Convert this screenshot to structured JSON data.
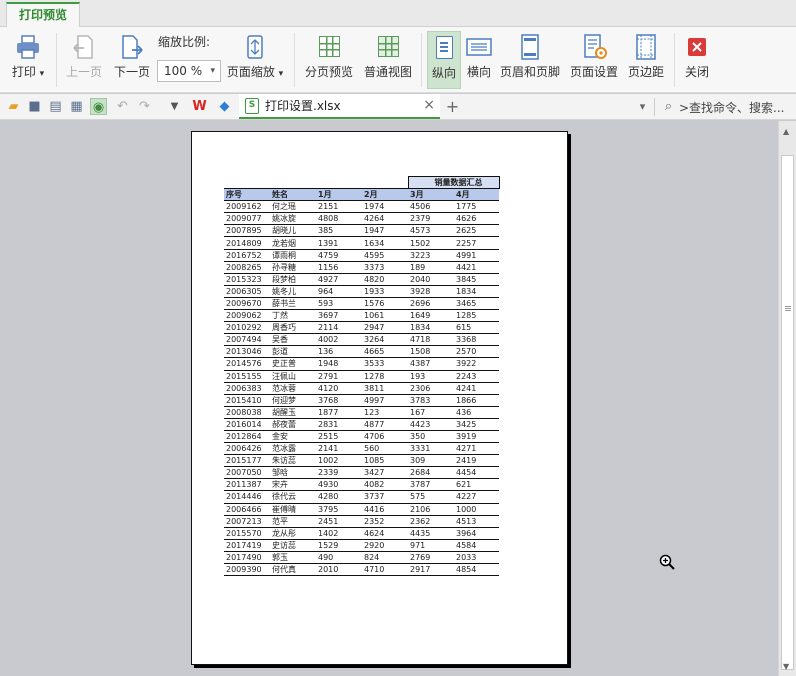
{
  "tabs": {
    "active": "打印预览"
  },
  "ribbon": {
    "print": "打印",
    "print_caret": "▾",
    "prev_page": "上一页",
    "next_page": "下一页",
    "zoom_label": "缩放比例:",
    "zoom_value": "100 %",
    "zoom_caret": "▾",
    "page_zoom": "页面缩放",
    "page_zoom_caret": "▾",
    "page_break_preview": "分页预览",
    "normal_view": "普通视图",
    "portrait": "纵向",
    "landscape": "横向",
    "header_footer": "页眉和页脚",
    "page_setup": "页面设置",
    "margins": "页边距",
    "close": "关闭"
  },
  "quickbar": {
    "filename": "打印设置.xlsx",
    "close_tab": "×",
    "new_tab": "+",
    "search": ">查找命令、搜索..."
  },
  "sheet": {
    "title": "销量数据汇总",
    "headers": [
      "序号",
      "姓名",
      "1月",
      "2月",
      "3月",
      "4月"
    ],
    "rows": [
      [
        "2009162",
        "何之瑶",
        "2151",
        "1974",
        "4506",
        "1775"
      ],
      [
        "2009077",
        "姚冰旋",
        "4808",
        "4264",
        "2379",
        "4626"
      ],
      [
        "2007895",
        "胡晓儿",
        "385",
        "1947",
        "4573",
        "2625"
      ],
      [
        "2014809",
        "龙若烟",
        "1391",
        "1634",
        "1502",
        "2257"
      ],
      [
        "2016752",
        "谭雨桐",
        "4759",
        "4595",
        "3223",
        "4991"
      ],
      [
        "2008265",
        "孙寻糖",
        "1156",
        "3373",
        "189",
        "4421"
      ],
      [
        "2015323",
        "段梦柏",
        "4927",
        "4820",
        "2040",
        "3845"
      ],
      [
        "2006305",
        "姚冬儿",
        "964",
        "1933",
        "3928",
        "1834"
      ],
      [
        "2009670",
        "薛书兰",
        "593",
        "1576",
        "2696",
        "3465"
      ],
      [
        "2009062",
        "丁然",
        "3697",
        "1061",
        "1649",
        "1285"
      ],
      [
        "2010292",
        "周香巧",
        "2114",
        "2947",
        "1834",
        "615"
      ],
      [
        "2007494",
        "吴香",
        "4002",
        "3264",
        "4718",
        "3368"
      ],
      [
        "2013046",
        "彭道",
        "136",
        "4665",
        "1508",
        "2570"
      ],
      [
        "2014576",
        "史正普",
        "1948",
        "3533",
        "4387",
        "3922"
      ],
      [
        "2015155",
        "汪佩山",
        "2791",
        "1278",
        "193",
        "2243"
      ],
      [
        "2006383",
        "范冰蓉",
        "4120",
        "3811",
        "2306",
        "4241"
      ],
      [
        "2015410",
        "何迎梦",
        "3768",
        "4997",
        "3783",
        "1866"
      ],
      [
        "2008038",
        "胡醒玉",
        "1877",
        "123",
        "167",
        "436"
      ],
      [
        "2016014",
        "郝夜蕾",
        "2831",
        "4877",
        "4423",
        "3425"
      ],
      [
        "2012864",
        "金安",
        "2515",
        "4706",
        "350",
        "3919"
      ],
      [
        "2006426",
        "范冰露",
        "2141",
        "560",
        "3331",
        "4271"
      ],
      [
        "2015177",
        "朱访蕊",
        "1002",
        "1085",
        "309",
        "2419"
      ],
      [
        "2007050",
        "邹晗",
        "2339",
        "3427",
        "2684",
        "4454"
      ],
      [
        "2011387",
        "宋卉",
        "4930",
        "4082",
        "3787",
        "621"
      ],
      [
        "2014446",
        "徐代云",
        "4280",
        "3737",
        "575",
        "4227"
      ],
      [
        "2006466",
        "崔傅晴",
        "3795",
        "4416",
        "2106",
        "1000"
      ],
      [
        "2007213",
        "范平",
        "2451",
        "2352",
        "2362",
        "4513"
      ],
      [
        "2015570",
        "龙从彤",
        "1402",
        "4624",
        "4435",
        "3964"
      ],
      [
        "2017419",
        "史访蕊",
        "1529",
        "2920",
        "971",
        "4584"
      ],
      [
        "2017490",
        "郭玉",
        "490",
        "824",
        "2769",
        "2033"
      ],
      [
        "2009390",
        "何代真",
        "2010",
        "4710",
        "2917",
        "4854"
      ]
    ]
  }
}
